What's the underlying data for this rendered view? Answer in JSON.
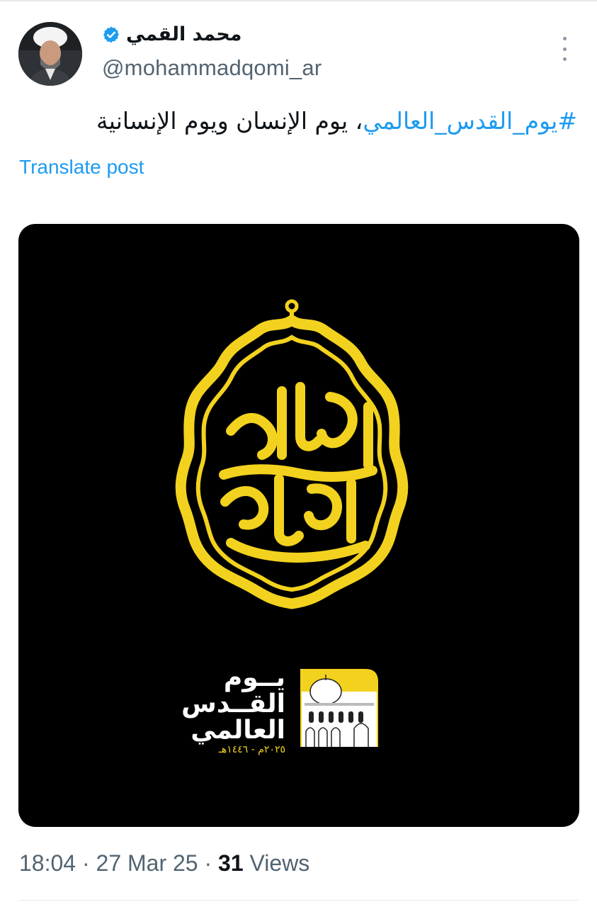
{
  "post": {
    "author": {
      "display_name": "محمد القمي",
      "handle": "@mohammadqomi_ar",
      "verified": true,
      "avatar_icon": "user-avatar"
    },
    "more_icon": "more-options-icon",
    "text": {
      "hashtag": "#يوم_القدس_العالمي",
      "rest": "، يوم الإنسان ويوم الإنسانية"
    },
    "translate_label": "Translate post",
    "media": {
      "calligraphy_text": "يا قدس إنا على العهد",
      "logo_lines": [
        "يــوم",
        "القــدس",
        "العالمي"
      ],
      "logo_date": "٢٠٢٥م - ١٤٤٦هـ",
      "colors": {
        "background": "#000000",
        "accent": "#f2d21e"
      }
    },
    "meta": {
      "time": "18:04",
      "separator": " · ",
      "date": "27 Mar 25",
      "views_count": "31",
      "views_label": " Views"
    }
  },
  "colors": {
    "link": "#1d9bf0",
    "muted": "#536471",
    "text": "#0f1419"
  }
}
